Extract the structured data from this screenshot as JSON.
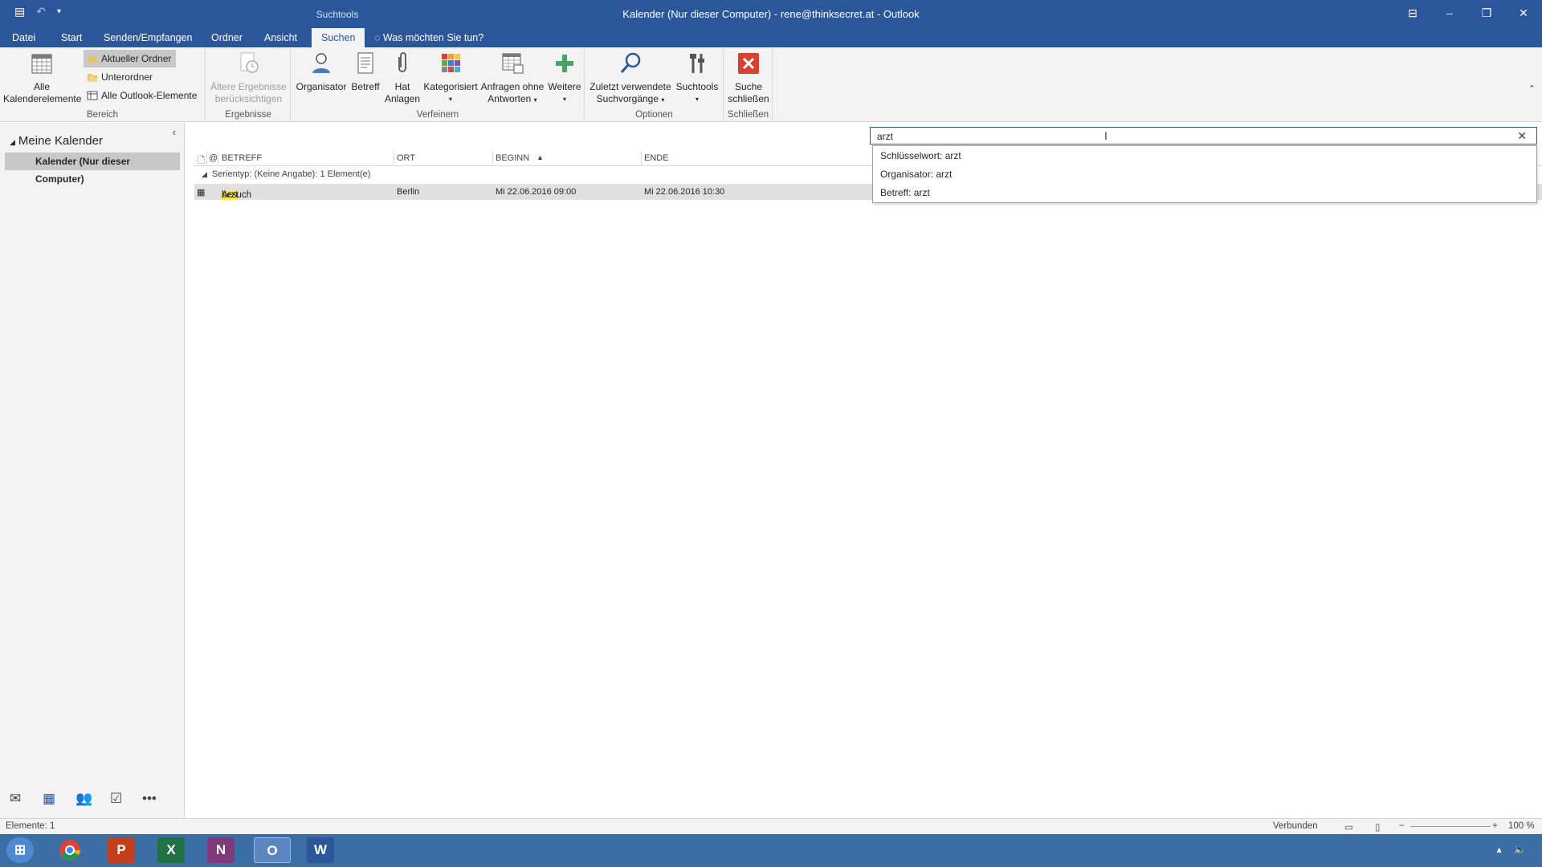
{
  "window": {
    "title": "Kalender (Nur dieser Computer) - rene@thinksecret.at - Outlook",
    "contextual_tab": "Suchtools"
  },
  "ribbon_tabs": [
    {
      "label": "Datei"
    },
    {
      "label": "Start"
    },
    {
      "label": "Senden/Empfangen"
    },
    {
      "label": "Ordner"
    },
    {
      "label": "Ansicht"
    },
    {
      "label": "Suchen"
    }
  ],
  "tell_me": "Was möchten Sie tun?",
  "ribbon": {
    "bereich": {
      "label": "Bereich",
      "all_items": "Alle Kalenderelemente",
      "current_folder": "Aktueller Ordner",
      "subfolders": "Unterordner",
      "all_outlook": "Alle Outlook-Elemente"
    },
    "ergebnisse": {
      "label": "Ergebnisse",
      "older_results": "Ältere Ergebnisse berücksichtigen"
    },
    "verfeinern": {
      "label": "Verfeinern",
      "organisator": "Organisator",
      "betreff": "Betreff",
      "hat_anlagen": "Hat Anlagen",
      "kategorisiert": "Kategorisiert",
      "anfragen": "Anfragen ohne Antworten",
      "weitere": "Weitere"
    },
    "optionen": {
      "label": "Optionen",
      "recent": "Zuletzt verwendete Suchvorgänge",
      "tools": "Suchtools"
    },
    "schliessen": {
      "label": "Schließen",
      "close_search": "Suche schließen"
    }
  },
  "folder_pane": {
    "header": "Meine Kalender",
    "selected_item": "Kalender (Nur dieser Computer)"
  },
  "list": {
    "columns": [
      "BETREFF",
      "ORT",
      "BEGINN",
      "ENDE"
    ],
    "group_header": "Serientyp: (Keine Angabe): 1 Element(e)",
    "rows": [
      {
        "subject_match": "Arzt",
        "subject_rest": "besuch",
        "location": "Berlin",
        "start": "Mi 22.06.2016 09:00",
        "end": "Mi 22.06.2016 10:30"
      }
    ]
  },
  "search": {
    "value": "arzt",
    "suggestions": [
      "Schlüsselwort: arzt",
      "Organisator: arzt",
      "Betreff: arzt"
    ]
  },
  "status": {
    "items": "Elemente: 1",
    "connection": "Verbunden",
    "zoom": "100 %"
  },
  "colors": {
    "accent": "#2b579a",
    "ribbon_bg": "#f3f3f3",
    "selection": "#c8c8c8",
    "highlight": "#ffe94d",
    "close_red": "#d9412f"
  }
}
